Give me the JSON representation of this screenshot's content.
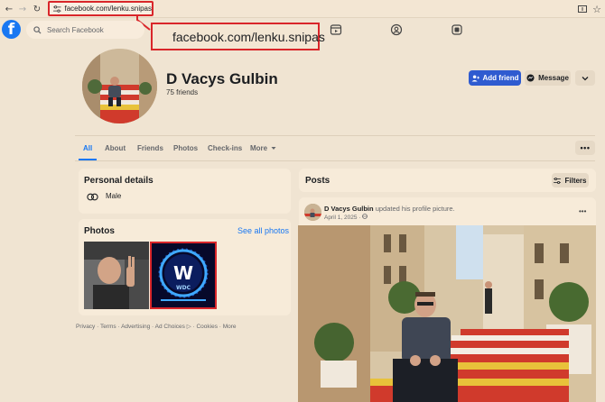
{
  "browser": {
    "url": "facebook.com/lenku.snipas",
    "zoomed_url": "facebook.com/lenku.snipas",
    "highlight_color": "#d9262a"
  },
  "header": {
    "search_placeholder": "Search Facebook",
    "brand_color": "#1877f2"
  },
  "profile": {
    "name": "D Vacys Gulbin",
    "friends": "75 friends",
    "add_friend_label": "Add friend",
    "message_label": "Message"
  },
  "tabs": [
    {
      "label": "All",
      "active": true
    },
    {
      "label": "About"
    },
    {
      "label": "Friends"
    },
    {
      "label": "Photos"
    },
    {
      "label": "Check-ins"
    },
    {
      "label": "More"
    }
  ],
  "personal_details": {
    "title": "Personal details",
    "gender": "Male"
  },
  "photos": {
    "title": "Photos",
    "see_all": "See all photos",
    "logo_text": "WDC"
  },
  "footer": "Privacy · Terms · Advertising · Ad Choices ▷ · Cookies · More",
  "posts": {
    "title": "Posts",
    "filters_label": "Filters",
    "items": [
      {
        "author": "D Vacys Gulbin",
        "action": "updated his profile picture.",
        "date": "April 1, 2025 ·"
      }
    ]
  }
}
